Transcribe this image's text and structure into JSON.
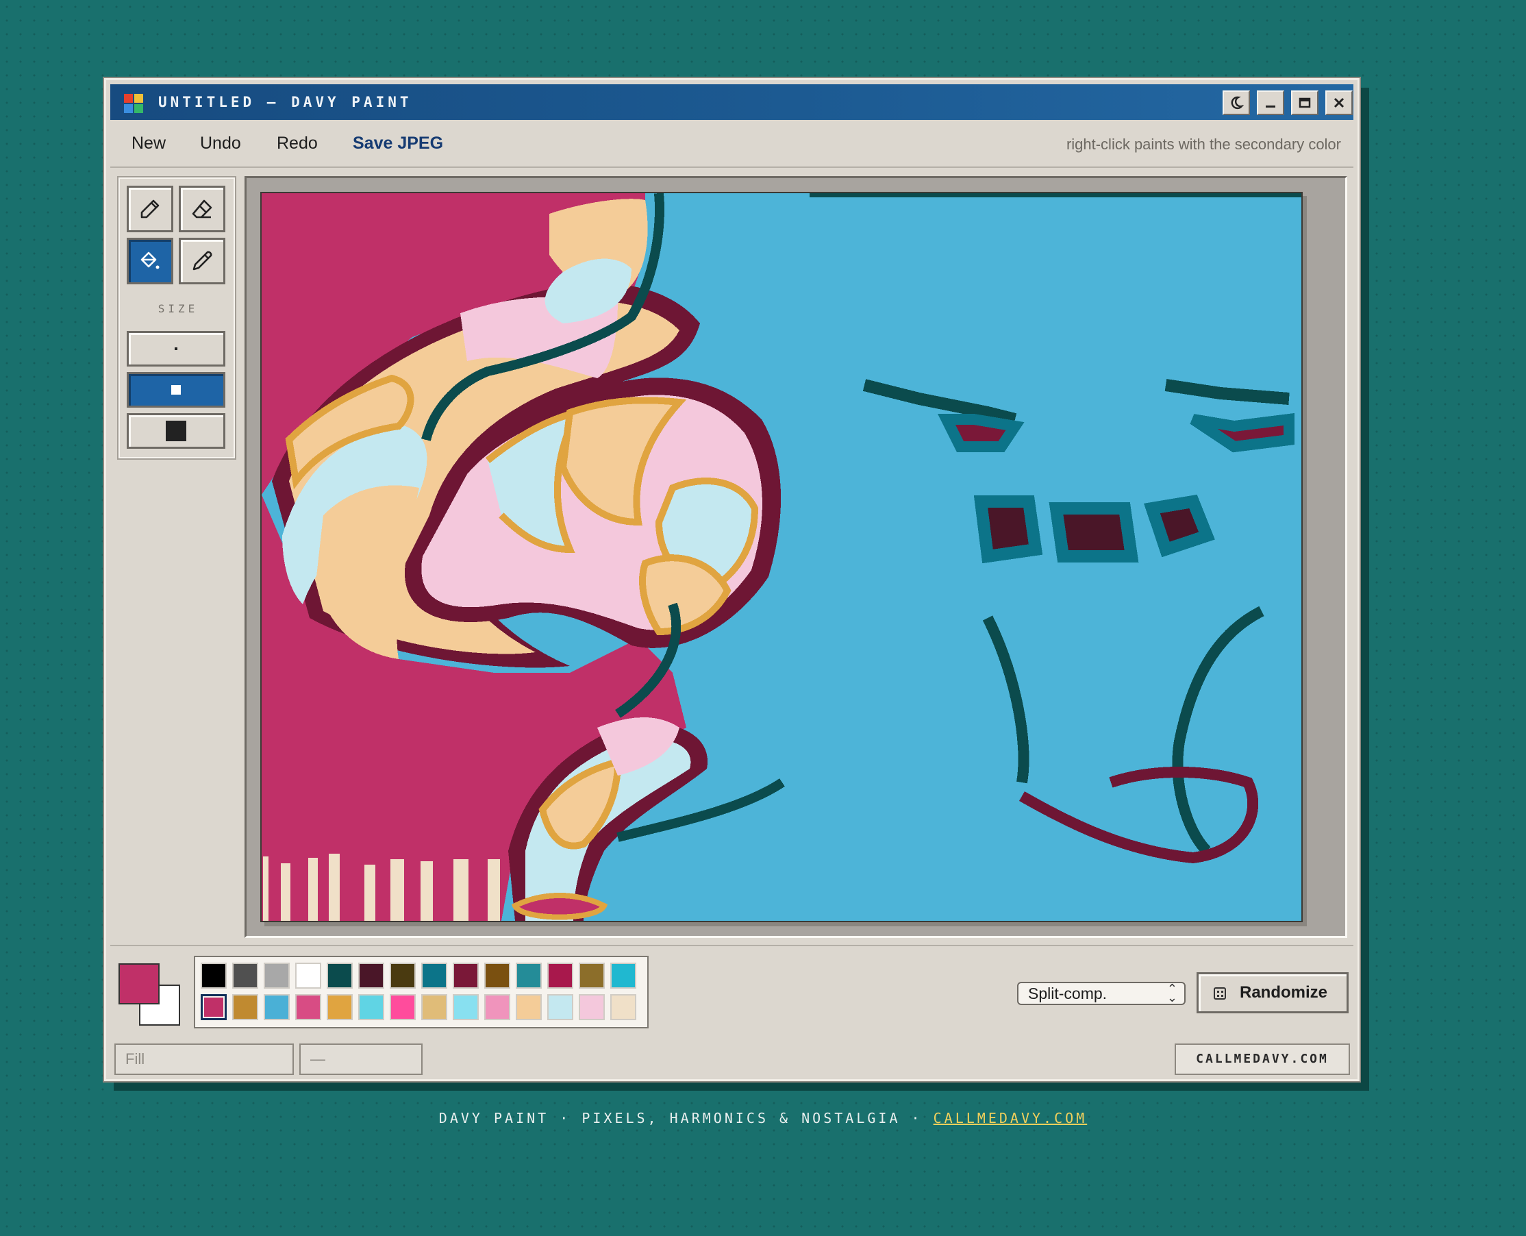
{
  "window": {
    "title": "UNTITLED — DAVY PAINT"
  },
  "titlebar_buttons": [
    "theme-toggle",
    "minimize",
    "maximize",
    "close"
  ],
  "menu": {
    "new": "New",
    "undo": "Undo",
    "redo": "Redo",
    "save": "Save JPEG"
  },
  "hint": "right-click paints with the secondary color",
  "tools": [
    {
      "name": "pencil",
      "icon": "pencil-icon",
      "active": false
    },
    {
      "name": "eraser",
      "icon": "eraser-icon",
      "active": false
    },
    {
      "name": "fill",
      "icon": "paint-bucket-icon",
      "active": true
    },
    {
      "name": "eyedropper",
      "icon": "eyedropper-icon",
      "active": false
    }
  ],
  "size": {
    "label": "SIZE",
    "options": [
      "small",
      "medium",
      "large"
    ],
    "selected": "medium"
  },
  "colors": {
    "primary": "#c03068",
    "secondary": "#ffffff",
    "accent": "#1e64a6"
  },
  "palette": [
    "#000000",
    "#505050",
    "#a8a8a8",
    "#ffffff",
    "#0b4b4d",
    "#4a1628",
    "#4a3a10",
    "#0c7489",
    "#7a1838",
    "#7a5010",
    "#248c98",
    "#a8184c",
    "#8c6e2a",
    "#20b8d0",
    "#c03068",
    "#c08a30",
    "#4ab0d6",
    "#d84c84",
    "#e0a440",
    "#60d4e4",
    "#ff4c9c",
    "#e0bc78",
    "#88e0f0",
    "#f094bc",
    "#f4cc98",
    "#c4e8f0",
    "#f4c8dc",
    "#f0e0c8"
  ],
  "palette_selected_index": 14,
  "harmony": {
    "value": "Split-comp."
  },
  "randomize": {
    "label": "Randomize"
  },
  "status": {
    "tool": "Fill",
    "coords": "—"
  },
  "site_badge": "CALLMEDAVY.COM",
  "footer": {
    "text": "DAVY PAINT · PIXELS, HARMONICS & NOSTALGIA · ",
    "link": "CALLMEDAVY.COM"
  }
}
